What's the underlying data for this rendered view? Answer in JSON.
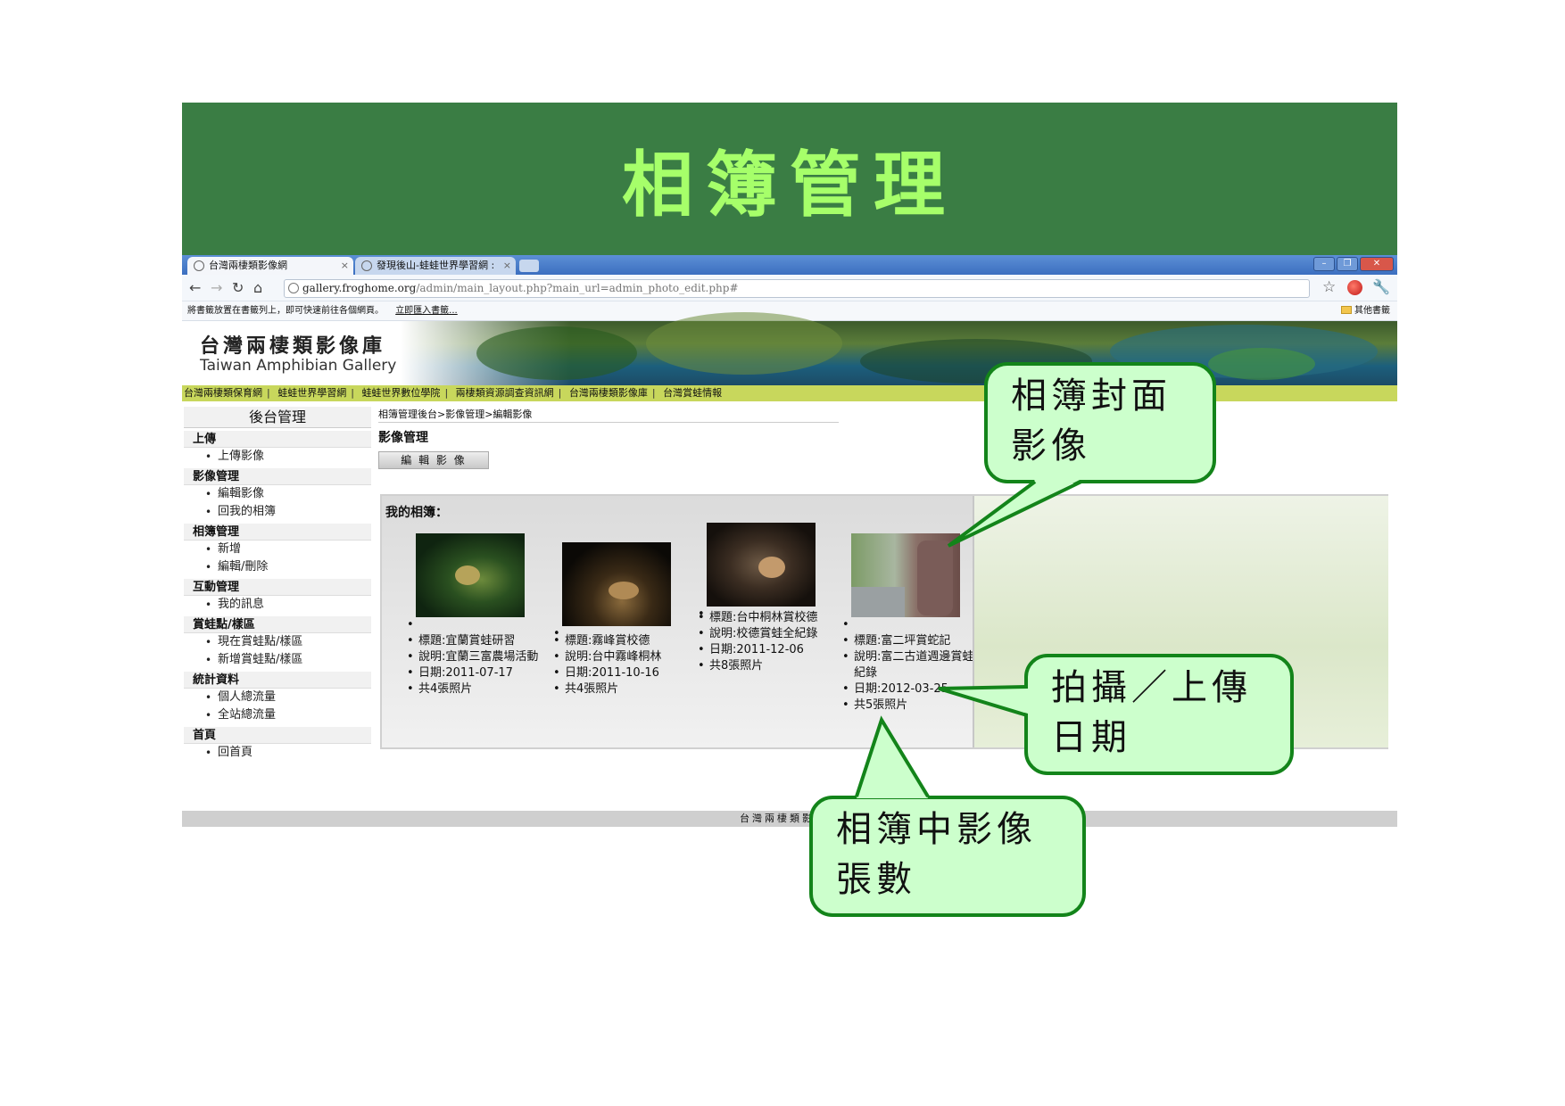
{
  "slide": {
    "title": "相簿管理"
  },
  "browser": {
    "tabs": [
      {
        "label": "台灣兩棲類影像網"
      },
      {
        "label": "發現後山-蛙蛙世界學習網 :"
      }
    ],
    "address": {
      "host": "gallery.froghome.org",
      "path": "/admin/main_layout.php?main_url=admin_photo_edit.php#"
    },
    "bookmark_bar": {
      "hint": "將書籤放置在書籤列上，即可快速前往各個網頁。",
      "import_link": "立即匯入書籤...",
      "other_bookmarks": "其他書籤"
    }
  },
  "site": {
    "logo_zh": "台灣兩棲類影像庫",
    "logo_en": "Taiwan Amphibian Gallery",
    "nav": [
      "台灣兩棲類保育網",
      "蛙蛙世界學習網",
      "蛙蛙世界數位學院",
      "兩棲類資源調查資訊網",
      "台灣兩棲類影像庫",
      "台灣賞蛙情報"
    ],
    "footer": "台灣兩棲類影像網"
  },
  "sidebar": {
    "title": "後台管理",
    "sections": [
      {
        "label": "上傳",
        "items": [
          "上傳影像"
        ]
      },
      {
        "label": "影像管理",
        "items": [
          "編輯影像",
          "回我的相簿"
        ]
      },
      {
        "label": "相簿管理",
        "items": [
          "新增",
          "編輯/刪除"
        ]
      },
      {
        "label": "互動管理",
        "items": [
          "我的訊息"
        ]
      },
      {
        "label": "賞蛙點/樣區",
        "items": [
          "現在賞蛙點/樣區",
          "新增賞蛙點/樣區"
        ]
      },
      {
        "label": "統計資料",
        "items": [
          "個人總流量",
          "全站總流量"
        ]
      },
      {
        "label": "首頁",
        "items": [
          "回首頁"
        ]
      }
    ]
  },
  "main": {
    "breadcrumb": "相簿管理後台>影像管理>編輯影像",
    "section_heading": "影像管理",
    "edit_button": "編 輯 影 像",
    "albums_heading": "我的相簿：",
    "albums": [
      {
        "title": "標題:宜蘭賞蛙研習",
        "desc": "說明:宜蘭三富農場活動",
        "date": "日期:2011-07-17",
        "count": "共4張照片"
      },
      {
        "title": "標題:霧峰賞校德",
        "desc": "說明:台中霧峰桐林",
        "date": "日期:2011-10-16",
        "count": "共4張照片"
      },
      {
        "title": "標題:台中桐林賞校德",
        "desc": "說明:校德賞蛙全紀錄",
        "date": "日期:2011-12-06",
        "count": "共8張照片"
      },
      {
        "title": "標題:富二坪賞蛇記",
        "desc": "說明:富二古道週邊賞蛙紀錄",
        "date": "日期:2012-03-25",
        "count": "共5張照片"
      }
    ]
  },
  "callouts": {
    "cover": [
      "相簿封面",
      "影像"
    ],
    "date": [
      "拍攝／上傳",
      "日期"
    ],
    "count": [
      "相簿中影像",
      "張數"
    ]
  },
  "colors": {
    "header_green": "#3a7d44",
    "title_green": "#a6ff6a",
    "callout_fill": "#ccffcc",
    "callout_border": "#13841a",
    "site_nav": "#c8d75c"
  },
  "icons": [
    "globe-icon",
    "back-icon",
    "forward-icon",
    "reload-icon",
    "home-icon",
    "star-icon",
    "wrench-icon",
    "folder-icon"
  ]
}
